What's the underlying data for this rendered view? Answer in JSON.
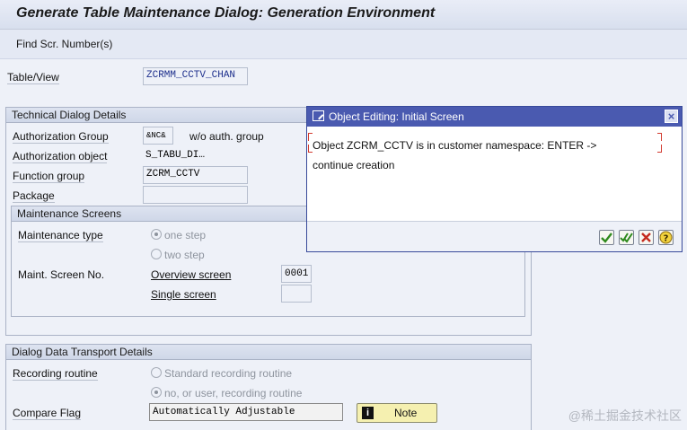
{
  "window": {
    "title": "Generate Table Maintenance Dialog: Generation Environment"
  },
  "toolbar": {
    "find_screen_number": "Find Scr. Number(s)"
  },
  "table_view": {
    "label": "Table/View",
    "value": "ZCRMM_CCTV_CHAN"
  },
  "technical": {
    "header": "Technical Dialog Details",
    "auth_group_label": "Authorization Group",
    "auth_group_value": "&NC&",
    "auth_group_text": "w/o auth. group",
    "auth_object_label": "Authorization object",
    "auth_object_value": "S_TABU_DI…",
    "function_group_label": "Function group",
    "function_group_value": "ZCRM_CCTV",
    "package_label": "Package",
    "package_value": ""
  },
  "maintenance_screens": {
    "header": "Maintenance Screens",
    "type_label": "Maintenance type",
    "one_step": "one step",
    "two_step": "two step",
    "screen_no_label": "Maint. Screen No.",
    "overview_label": "Overview screen",
    "overview_value": "0001",
    "single_label": "Single screen",
    "single_value": ""
  },
  "transport": {
    "header": "Dialog Data Transport Details",
    "recording_label": "Recording routine",
    "standard": "Standard recording routine",
    "no_user": "no, or user, recording routine",
    "compare_label": "Compare Flag",
    "compare_value": "Automatically Adjustable",
    "note_label": "Note"
  },
  "dialog": {
    "title": "Object Editing: Initial Screen",
    "message_line1": "Object ZCRM_CCTV is in customer namespace: ENTER ->",
    "message_line2": "continue creation"
  },
  "watermark": "@稀土掘金技术社区",
  "colors": {
    "dialog_title_bg": "#4a5ab0",
    "accent_red": "#d23a2f",
    "note_bg": "#f5f0b0"
  }
}
